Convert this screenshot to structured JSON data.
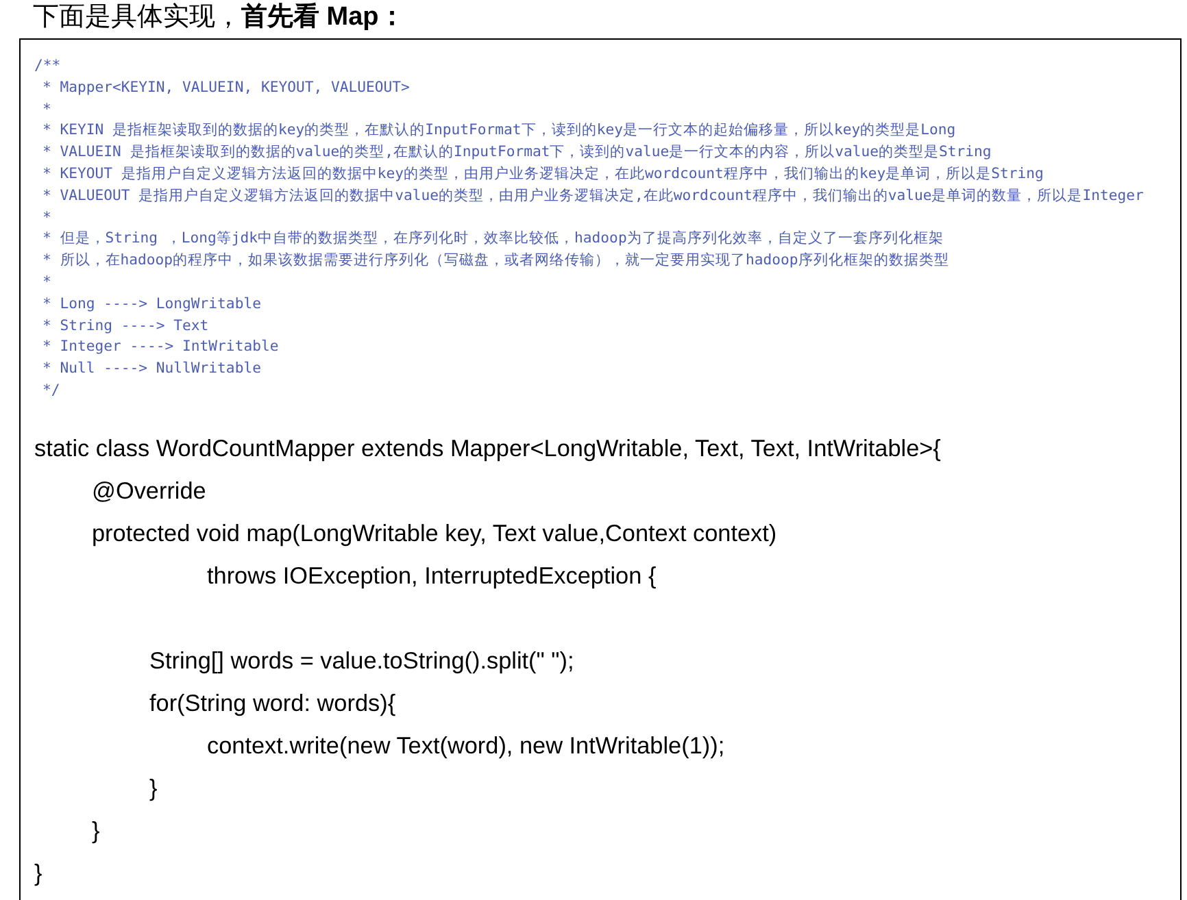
{
  "heading": "下面是具体实现，**首先看 Map：**",
  "comment_lines": [
    "/**",
    "* Mapper<KEYIN, VALUEIN, KEYOUT, VALUEOUT>",
    "*",
    "* KEYIN 是指框架读取到的数据的key的类型，在默认的InputFormat下，读到的key是一行文本的起始偏移量，所以key的类型是Long",
    "* VALUEIN 是指框架读取到的数据的value的类型,在默认的InputFormat下，读到的value是一行文本的内容，所以value的类型是String",
    "* KEYOUT 是指用户自定义逻辑方法返回的数据中key的类型，由用户业务逻辑决定，在此wordcount程序中，我们输出的key是单词，所以是String",
    "* VALUEOUT 是指用户自定义逻辑方法返回的数据中value的类型，由用户业务逻辑决定,在此wordcount程序中，我们输出的value是单词的数量，所以是Integer",
    "*",
    "* 但是，String ，Long等jdk中自带的数据类型，在序列化时，效率比较低，hadoop为了提高序列化效率，自定义了一套序列化框架",
    "* 所以，在hadoop的程序中，如果该数据需要进行序列化（写磁盘，或者网络传输），就一定要用实现了hadoop序列化框架的数据类型",
    "*",
    "* Long ----> LongWritable",
    "* String ----> Text",
    "* Integer ----> IntWritable",
    "* Null ----> NullWritable",
    "*/"
  ],
  "code": [
    {
      "kind": "line",
      "text": "static class WordCountMapper extends Mapper<LongWritable, Text, Text, IntWritable>{",
      "children": [
        {
          "kind": "line",
          "text": "@Override"
        },
        {
          "kind": "line",
          "text": "protected void map(LongWritable key, Text value,Context context)",
          "children": [
            {
              "kind": "continuation",
              "text": "throws IOException, InterruptedException {"
            },
            {
              "kind": "blank"
            },
            {
              "kind": "line",
              "text": "String[] words = value.toString().split(\" \");"
            },
            {
              "kind": "line",
              "text": "for(String word: words){",
              "children": [
                {
                  "kind": "line",
                  "text": "context.write(new Text(word), new IntWritable(1));"
                }
              ]
            },
            {
              "kind": "line",
              "text": "}"
            }
          ]
        },
        {
          "kind": "line",
          "text": "}"
        }
      ]
    },
    {
      "kind": "line",
      "text": "}"
    }
  ]
}
